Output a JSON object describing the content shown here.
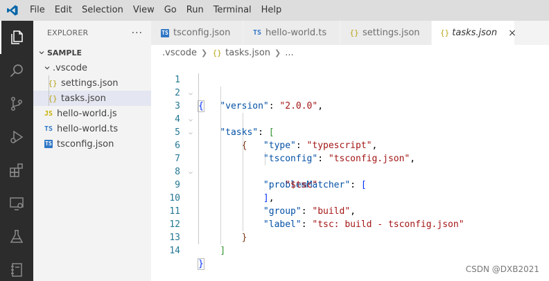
{
  "menubar": {
    "items": [
      "File",
      "Edit",
      "Selection",
      "View",
      "Go",
      "Run",
      "Terminal",
      "Help"
    ]
  },
  "activitybar": {
    "icons": [
      "explorer-icon",
      "search-icon",
      "source-control-icon",
      "run-debug-icon",
      "extensions-icon",
      "remote-explorer-icon",
      "testing-icon",
      "notebook-icon"
    ]
  },
  "sidebar": {
    "title": "EXPLORER",
    "more": "···",
    "root": "SAMPLE",
    "folder": ".vscode",
    "items": [
      {
        "label": "settings.json",
        "icon": "{}"
      },
      {
        "label": "tasks.json",
        "icon": "{}"
      },
      {
        "label": "hello-world.js",
        "icon": "JS"
      },
      {
        "label": "hello-world.ts",
        "icon": "TS"
      },
      {
        "label": "tsconfig.json",
        "icon": "TS"
      }
    ]
  },
  "tabs": [
    {
      "label": "tsconfig.json",
      "icon": "TS"
    },
    {
      "label": "hello-world.ts",
      "icon": "TS"
    },
    {
      "label": "settings.json",
      "icon": "{}"
    },
    {
      "label": "tasks.json",
      "icon": "{}",
      "close": "×"
    }
  ],
  "breadcrumb": {
    "folder": ".vscode",
    "file": "tasks.json",
    "icon": "{}",
    "more": "..."
  },
  "editor": {
    "line_numbers": [
      "1",
      "2",
      "3",
      "4",
      "5",
      "6",
      "7",
      "8",
      "9",
      "10",
      "11",
      "12",
      "13",
      "14"
    ],
    "code": {
      "version_key": "\"version\"",
      "version_val": "\"2.0.0\"",
      "tasks_key": "\"tasks\"",
      "type_key": "\"type\"",
      "type_val": "\"typescript\"",
      "tsconfig_key": "\"tsconfig\"",
      "tsconfig_val": "\"tsconfig.json\"",
      "pm_key": "\"problemMatcher\"",
      "pm_val": "\"$tsc\"",
      "group_key": "\"group\"",
      "group_val": "\"build\"",
      "label_key": "\"label\"",
      "label_val": "\"tsc: build - tsconfig.json\""
    }
  },
  "watermark": "CSDN @DXB2021",
  "colors": {
    "accent": "#0065a9",
    "key": "#0451a5",
    "string": "#a31515",
    "line_number": "#237893"
  }
}
